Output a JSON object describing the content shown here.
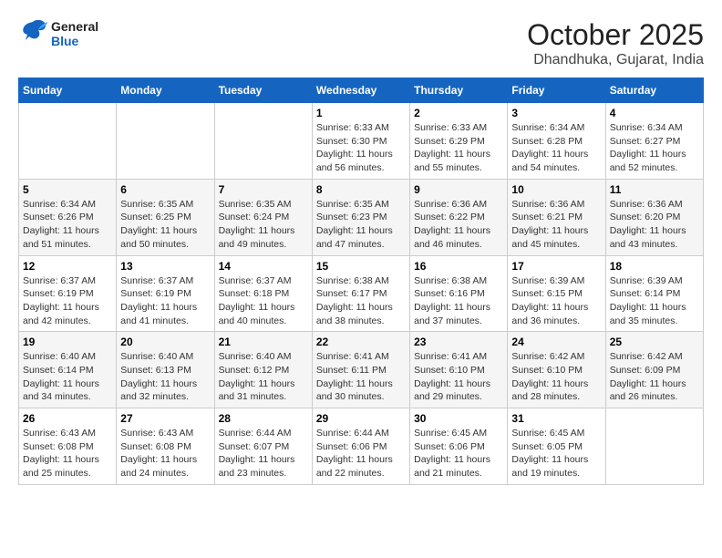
{
  "header": {
    "logo_general": "General",
    "logo_blue": "Blue",
    "month_title": "October 2025",
    "location": "Dhandhuka, Gujarat, India"
  },
  "calendar": {
    "days_of_week": [
      "Sunday",
      "Monday",
      "Tuesday",
      "Wednesday",
      "Thursday",
      "Friday",
      "Saturday"
    ],
    "weeks": [
      [
        {
          "day": "",
          "sunrise": "",
          "sunset": "",
          "daylight": ""
        },
        {
          "day": "",
          "sunrise": "",
          "sunset": "",
          "daylight": ""
        },
        {
          "day": "",
          "sunrise": "",
          "sunset": "",
          "daylight": ""
        },
        {
          "day": "1",
          "sunrise": "Sunrise: 6:33 AM",
          "sunset": "Sunset: 6:30 PM",
          "daylight": "Daylight: 11 hours and 56 minutes."
        },
        {
          "day": "2",
          "sunrise": "Sunrise: 6:33 AM",
          "sunset": "Sunset: 6:29 PM",
          "daylight": "Daylight: 11 hours and 55 minutes."
        },
        {
          "day": "3",
          "sunrise": "Sunrise: 6:34 AM",
          "sunset": "Sunset: 6:28 PM",
          "daylight": "Daylight: 11 hours and 54 minutes."
        },
        {
          "day": "4",
          "sunrise": "Sunrise: 6:34 AM",
          "sunset": "Sunset: 6:27 PM",
          "daylight": "Daylight: 11 hours and 52 minutes."
        }
      ],
      [
        {
          "day": "5",
          "sunrise": "Sunrise: 6:34 AM",
          "sunset": "Sunset: 6:26 PM",
          "daylight": "Daylight: 11 hours and 51 minutes."
        },
        {
          "day": "6",
          "sunrise": "Sunrise: 6:35 AM",
          "sunset": "Sunset: 6:25 PM",
          "daylight": "Daylight: 11 hours and 50 minutes."
        },
        {
          "day": "7",
          "sunrise": "Sunrise: 6:35 AM",
          "sunset": "Sunset: 6:24 PM",
          "daylight": "Daylight: 11 hours and 49 minutes."
        },
        {
          "day": "8",
          "sunrise": "Sunrise: 6:35 AM",
          "sunset": "Sunset: 6:23 PM",
          "daylight": "Daylight: 11 hours and 47 minutes."
        },
        {
          "day": "9",
          "sunrise": "Sunrise: 6:36 AM",
          "sunset": "Sunset: 6:22 PM",
          "daylight": "Daylight: 11 hours and 46 minutes."
        },
        {
          "day": "10",
          "sunrise": "Sunrise: 6:36 AM",
          "sunset": "Sunset: 6:21 PM",
          "daylight": "Daylight: 11 hours and 45 minutes."
        },
        {
          "day": "11",
          "sunrise": "Sunrise: 6:36 AM",
          "sunset": "Sunset: 6:20 PM",
          "daylight": "Daylight: 11 hours and 43 minutes."
        }
      ],
      [
        {
          "day": "12",
          "sunrise": "Sunrise: 6:37 AM",
          "sunset": "Sunset: 6:19 PM",
          "daylight": "Daylight: 11 hours and 42 minutes."
        },
        {
          "day": "13",
          "sunrise": "Sunrise: 6:37 AM",
          "sunset": "Sunset: 6:19 PM",
          "daylight": "Daylight: 11 hours and 41 minutes."
        },
        {
          "day": "14",
          "sunrise": "Sunrise: 6:37 AM",
          "sunset": "Sunset: 6:18 PM",
          "daylight": "Daylight: 11 hours and 40 minutes."
        },
        {
          "day": "15",
          "sunrise": "Sunrise: 6:38 AM",
          "sunset": "Sunset: 6:17 PM",
          "daylight": "Daylight: 11 hours and 38 minutes."
        },
        {
          "day": "16",
          "sunrise": "Sunrise: 6:38 AM",
          "sunset": "Sunset: 6:16 PM",
          "daylight": "Daylight: 11 hours and 37 minutes."
        },
        {
          "day": "17",
          "sunrise": "Sunrise: 6:39 AM",
          "sunset": "Sunset: 6:15 PM",
          "daylight": "Daylight: 11 hours and 36 minutes."
        },
        {
          "day": "18",
          "sunrise": "Sunrise: 6:39 AM",
          "sunset": "Sunset: 6:14 PM",
          "daylight": "Daylight: 11 hours and 35 minutes."
        }
      ],
      [
        {
          "day": "19",
          "sunrise": "Sunrise: 6:40 AM",
          "sunset": "Sunset: 6:14 PM",
          "daylight": "Daylight: 11 hours and 34 minutes."
        },
        {
          "day": "20",
          "sunrise": "Sunrise: 6:40 AM",
          "sunset": "Sunset: 6:13 PM",
          "daylight": "Daylight: 11 hours and 32 minutes."
        },
        {
          "day": "21",
          "sunrise": "Sunrise: 6:40 AM",
          "sunset": "Sunset: 6:12 PM",
          "daylight": "Daylight: 11 hours and 31 minutes."
        },
        {
          "day": "22",
          "sunrise": "Sunrise: 6:41 AM",
          "sunset": "Sunset: 6:11 PM",
          "daylight": "Daylight: 11 hours and 30 minutes."
        },
        {
          "day": "23",
          "sunrise": "Sunrise: 6:41 AM",
          "sunset": "Sunset: 6:10 PM",
          "daylight": "Daylight: 11 hours and 29 minutes."
        },
        {
          "day": "24",
          "sunrise": "Sunrise: 6:42 AM",
          "sunset": "Sunset: 6:10 PM",
          "daylight": "Daylight: 11 hours and 28 minutes."
        },
        {
          "day": "25",
          "sunrise": "Sunrise: 6:42 AM",
          "sunset": "Sunset: 6:09 PM",
          "daylight": "Daylight: 11 hours and 26 minutes."
        }
      ],
      [
        {
          "day": "26",
          "sunrise": "Sunrise: 6:43 AM",
          "sunset": "Sunset: 6:08 PM",
          "daylight": "Daylight: 11 hours and 25 minutes."
        },
        {
          "day": "27",
          "sunrise": "Sunrise: 6:43 AM",
          "sunset": "Sunset: 6:08 PM",
          "daylight": "Daylight: 11 hours and 24 minutes."
        },
        {
          "day": "28",
          "sunrise": "Sunrise: 6:44 AM",
          "sunset": "Sunset: 6:07 PM",
          "daylight": "Daylight: 11 hours and 23 minutes."
        },
        {
          "day": "29",
          "sunrise": "Sunrise: 6:44 AM",
          "sunset": "Sunset: 6:06 PM",
          "daylight": "Daylight: 11 hours and 22 minutes."
        },
        {
          "day": "30",
          "sunrise": "Sunrise: 6:45 AM",
          "sunset": "Sunset: 6:06 PM",
          "daylight": "Daylight: 11 hours and 21 minutes."
        },
        {
          "day": "31",
          "sunrise": "Sunrise: 6:45 AM",
          "sunset": "Sunset: 6:05 PM",
          "daylight": "Daylight: 11 hours and 19 minutes."
        },
        {
          "day": "",
          "sunrise": "",
          "sunset": "",
          "daylight": ""
        }
      ]
    ]
  }
}
